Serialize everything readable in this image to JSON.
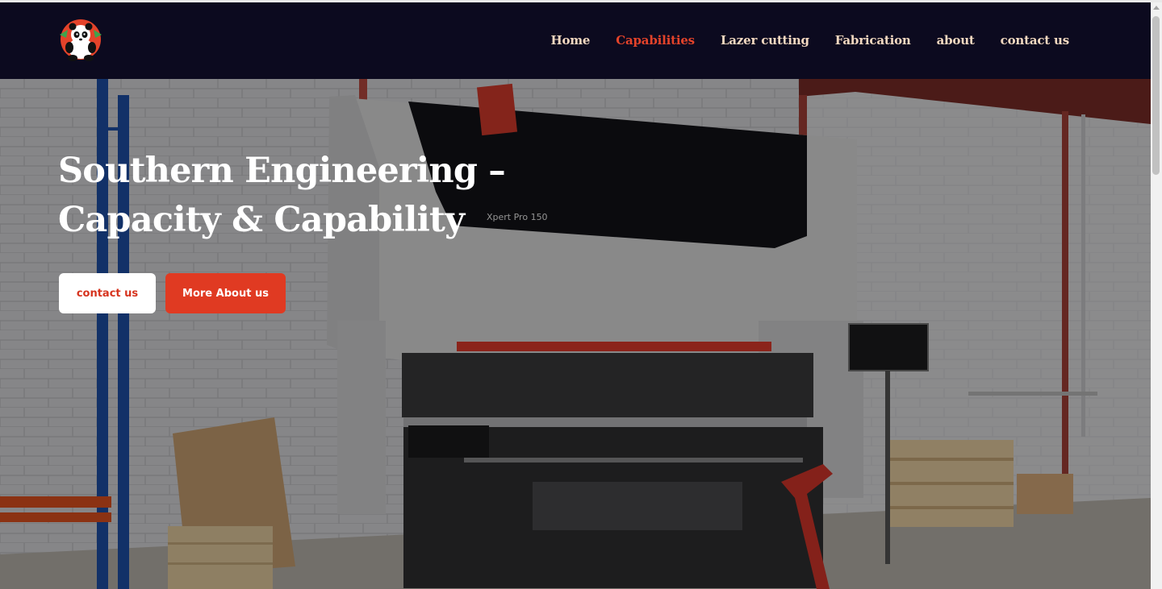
{
  "header": {
    "logo_icon": "panda-logo-icon",
    "nav": [
      {
        "label": "Home",
        "active": false
      },
      {
        "label": "Capabilities",
        "active": true
      },
      {
        "label": "Lazer cutting",
        "active": false
      },
      {
        "label": "Fabrication",
        "active": false
      },
      {
        "label": "about",
        "active": false
      },
      {
        "label": "contact us",
        "active": false
      }
    ]
  },
  "hero": {
    "title_line1": "Southern Engineering –",
    "title_line2": "Capacity & Capability",
    "machine_label": "Xpert Pro 150",
    "contact_button": "contact us",
    "about_button": "More About us"
  },
  "colors": {
    "header_bg": "#0c0a1f",
    "nav_text": "#f2d8c0",
    "nav_active": "#e4432a",
    "accent": "#e03a22"
  }
}
